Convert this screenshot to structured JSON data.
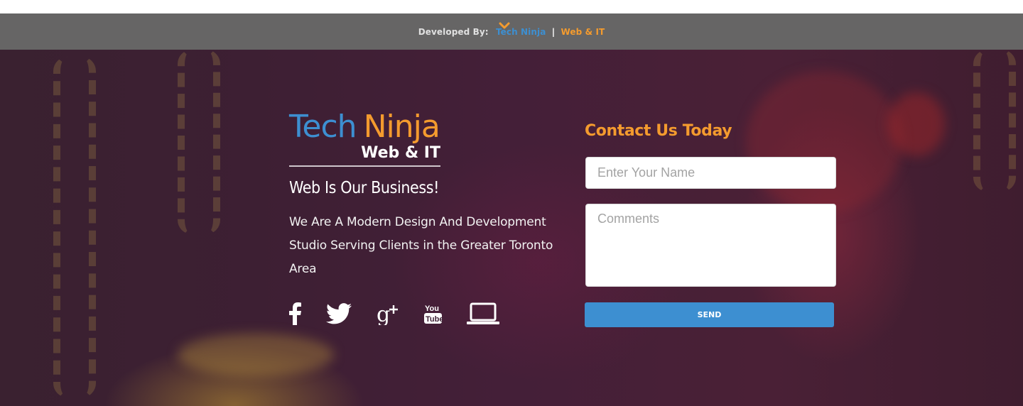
{
  "topbar": {
    "developed_by_label": "Developed By:",
    "brand_part1": "Tech Ninja",
    "separator": "|",
    "brand_part2": "Web & IT",
    "scroll_icon": "chevron-down-icon"
  },
  "brand": {
    "word1": "Tech",
    "word2": "Ninja",
    "subtitle": "Web & IT"
  },
  "tagline": "Web Is Our Business!",
  "description": "We Are A Modern Design And Development Studio Serving Clients in the Greater Toronto Area",
  "socials": [
    {
      "name": "facebook-icon"
    },
    {
      "name": "twitter-icon"
    },
    {
      "name": "google-plus-icon"
    },
    {
      "name": "youtube-icon"
    },
    {
      "name": "laptop-icon"
    }
  ],
  "contact": {
    "title": "Contact Us Today",
    "name_placeholder": "Enter Your Name",
    "comments_placeholder": "Comments",
    "send_label": "SEND"
  },
  "colors": {
    "blue": "#3d8fd1",
    "orange": "#f49b2e",
    "bar": "#666565"
  }
}
